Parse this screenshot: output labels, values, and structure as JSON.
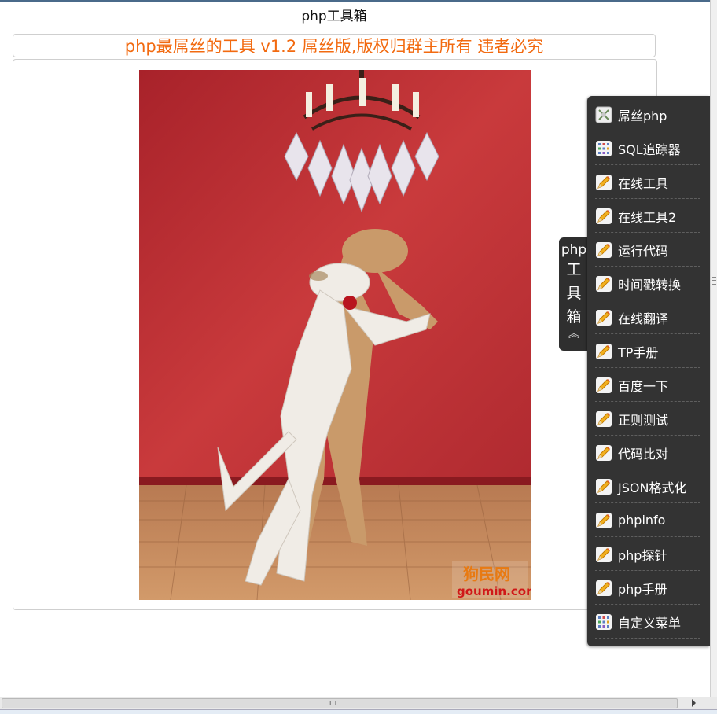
{
  "page": {
    "title": "php工具箱",
    "banner": "php最屌丝的工具 v1.2 屌丝版,版权归群主所有 违者必究"
  },
  "photo": {
    "watermark_cn": "狗民网",
    "watermark_en": "goumin.com"
  },
  "toggle_tab": {
    "line1": "php",
    "line2": "工",
    "line3": "具",
    "line4": "箱",
    "chevron": "︽"
  },
  "menu": [
    {
      "label": "屌丝php",
      "icon": "app-icon"
    },
    {
      "label": "SQL追踪器",
      "icon": "grid-icon"
    },
    {
      "label": "在线工具",
      "icon": "pencil-icon"
    },
    {
      "label": "在线工具2",
      "icon": "pencil-icon"
    },
    {
      "label": "运行代码",
      "icon": "pencil-icon"
    },
    {
      "label": "时间戳转换",
      "icon": "pencil-icon"
    },
    {
      "label": "在线翻译",
      "icon": "pencil-icon"
    },
    {
      "label": "TP手册",
      "icon": "pencil-icon"
    },
    {
      "label": "百度一下",
      "icon": "pencil-icon"
    },
    {
      "label": "正则测试",
      "icon": "pencil-icon"
    },
    {
      "label": "代码比对",
      "icon": "pencil-icon"
    },
    {
      "label": "JSON格式化",
      "icon": "pencil-icon"
    },
    {
      "label": "phpinfo",
      "icon": "pencil-icon"
    },
    {
      "label": "php探针",
      "icon": "pencil-icon"
    },
    {
      "label": "php手册",
      "icon": "pencil-icon"
    },
    {
      "label": "自定义菜单",
      "icon": "grid-icon"
    }
  ],
  "colors": {
    "banner_text": "#f26a10",
    "menu_bg": "#333333",
    "menu_text": "#ffffff"
  }
}
